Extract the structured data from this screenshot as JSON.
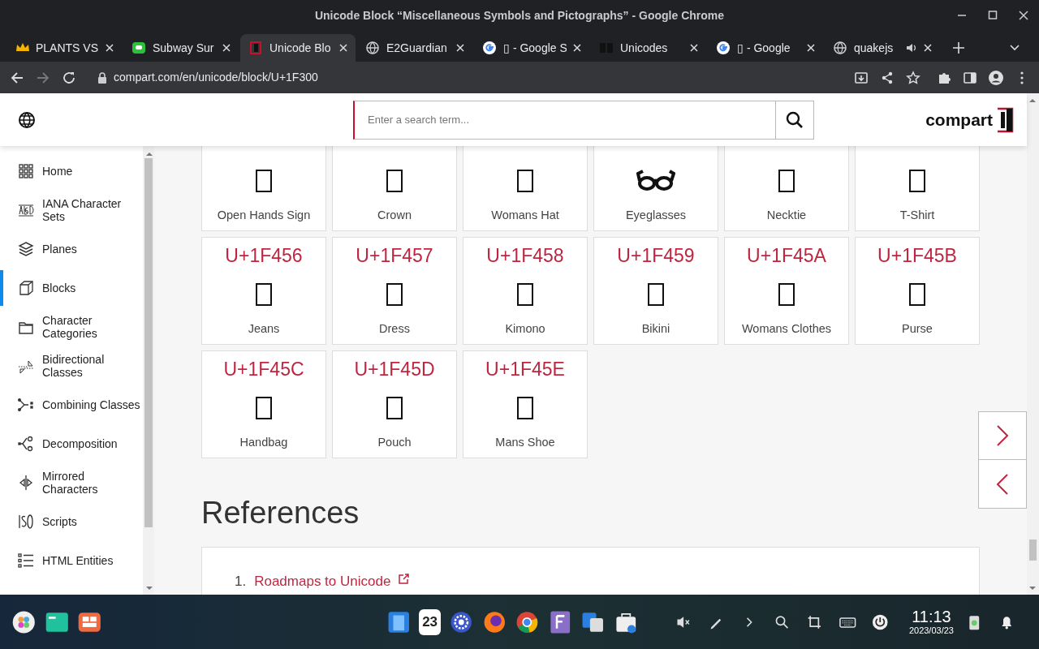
{
  "window": {
    "title": "Unicode Block “Miscellaneous Symbols and Pictographs” - Google Chrome"
  },
  "tabs": [
    {
      "label": "PLANTS VS",
      "selected": false,
      "audio": false
    },
    {
      "label": "Subway Sur",
      "selected": false,
      "audio": false
    },
    {
      "label": "Unicode Blo",
      "selected": true,
      "audio": false
    },
    {
      "label": "E2Guardian",
      "selected": false,
      "audio": false
    },
    {
      "label": "▯ - Google S",
      "selected": false,
      "audio": false
    },
    {
      "label": "Unicodes",
      "selected": false,
      "audio": false
    },
    {
      "label": "▯ - Google",
      "selected": false,
      "audio": false
    },
    {
      "label": "quakejs",
      "selected": false,
      "audio": true
    }
  ],
  "address_bar": {
    "url": "compart.com/en/unicode/block/U+1F300"
  },
  "header": {
    "search": {
      "placeholder": "Enter a search term..."
    },
    "logo": "compart"
  },
  "sidebar": {
    "items": [
      {
        "label": "Home",
        "selected": false
      },
      {
        "label": "IANA Character Sets",
        "selected": false
      },
      {
        "label": "Planes",
        "selected": false
      },
      {
        "label": "Blocks",
        "selected": true
      },
      {
        "label": "Character Categories",
        "selected": false
      },
      {
        "label": "Bidirectional Classes",
        "selected": false
      },
      {
        "label": "Combining Classes",
        "selected": false
      },
      {
        "label": "Decomposition",
        "selected": false
      },
      {
        "label": "Mirrored Characters",
        "selected": false
      },
      {
        "label": "Scripts",
        "selected": false
      },
      {
        "label": "HTML Entities",
        "selected": false
      }
    ]
  },
  "characters": [
    {
      "name": "Open Hands Sign",
      "kind": "tofu"
    },
    {
      "name": "Crown",
      "kind": "tofu"
    },
    {
      "name": "Womans Hat",
      "kind": "tofu"
    },
    {
      "name": "Eyeglasses",
      "kind": "eyeglasses"
    },
    {
      "name": "Necktie",
      "kind": "tofu"
    },
    {
      "name": "T-Shirt",
      "kind": "tofu"
    },
    {
      "code": "U+1F456",
      "name": "Jeans",
      "kind": "tofu"
    },
    {
      "code": "U+1F457",
      "name": "Dress",
      "kind": "tofu"
    },
    {
      "code": "U+1F458",
      "name": "Kimono",
      "kind": "tofu"
    },
    {
      "code": "U+1F459",
      "name": "Bikini",
      "kind": "tofu"
    },
    {
      "code": "U+1F45A",
      "name": "Womans Clothes",
      "kind": "tofu"
    },
    {
      "code": "U+1F45B",
      "name": "Purse",
      "kind": "tofu"
    },
    {
      "code": "U+1F45C",
      "name": "Handbag",
      "kind": "tofu"
    },
    {
      "code": "U+1F45D",
      "name": "Pouch",
      "kind": "tofu"
    },
    {
      "code": "U+1F45E",
      "name": "Mans Shoe",
      "kind": "tofu"
    }
  ],
  "references": {
    "heading": "References",
    "items": [
      {
        "number": "1.",
        "label": "Roadmaps to Unicode"
      }
    ]
  },
  "taskbar": {
    "calendar_day": "23",
    "time": "11:13",
    "date": "2023/03/23"
  }
}
